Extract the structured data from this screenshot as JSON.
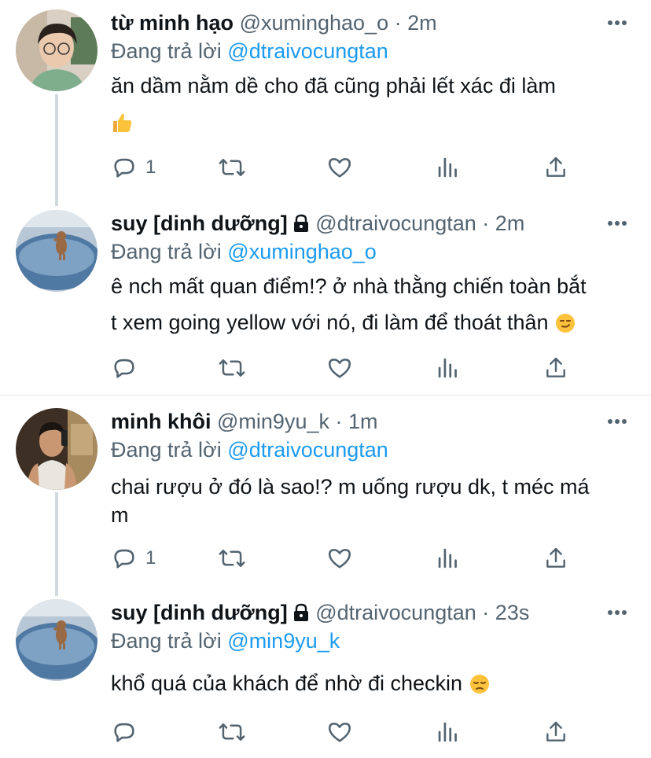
{
  "tweets": [
    {
      "name": "từ minh hạo",
      "handle": "@xuminghao_o",
      "time": "2m",
      "replying_label": "Đang trả lời",
      "replying_to": "@dtraivocungtan",
      "text_lines": [
        "ăn dầm nằm dề cho đã cũng phải lết xác đi làm"
      ],
      "emoji": "thumbs-up",
      "reply_count": "1",
      "locked": false
    },
    {
      "name": "suy [dinh dưỡng]",
      "handle": "@dtraivocungtan",
      "time": "2m",
      "replying_label": "Đang trả lời",
      "replying_to": "@xuminghao_o",
      "text_lines": [
        "ê nch mất quan điểm!? ở nhà thằng chiến toàn bắt",
        "t xem going yellow với nó, đi làm để thoát thân"
      ],
      "emoji": "smirk",
      "reply_count": "",
      "locked": true
    },
    {
      "name": "minh khôi",
      "handle": "@min9yu_k",
      "time": "1m",
      "replying_label": "Đang trả lời",
      "replying_to": "@dtraivocungtan",
      "text_lines": [
        "chai rượu ở đó là sao!? m uống rượu dk, t méc má",
        "m"
      ],
      "emoji": "",
      "reply_count": "1",
      "locked": false
    },
    {
      "name": "suy [dinh dưỡng]",
      "handle": "@dtraivocungtan",
      "time": "23s",
      "replying_label": "Đang trả lời",
      "replying_to": "@min9yu_k",
      "text_lines": [
        "khổ quá của khách để nhờ đi checkin"
      ],
      "emoji": "pensive",
      "reply_count": "",
      "locked": true
    }
  ],
  "separator": "·",
  "colors": {
    "accent": "#1d9bf0",
    "muted": "#536471",
    "text": "#0f1419",
    "thread_line": "#cfd9de"
  }
}
